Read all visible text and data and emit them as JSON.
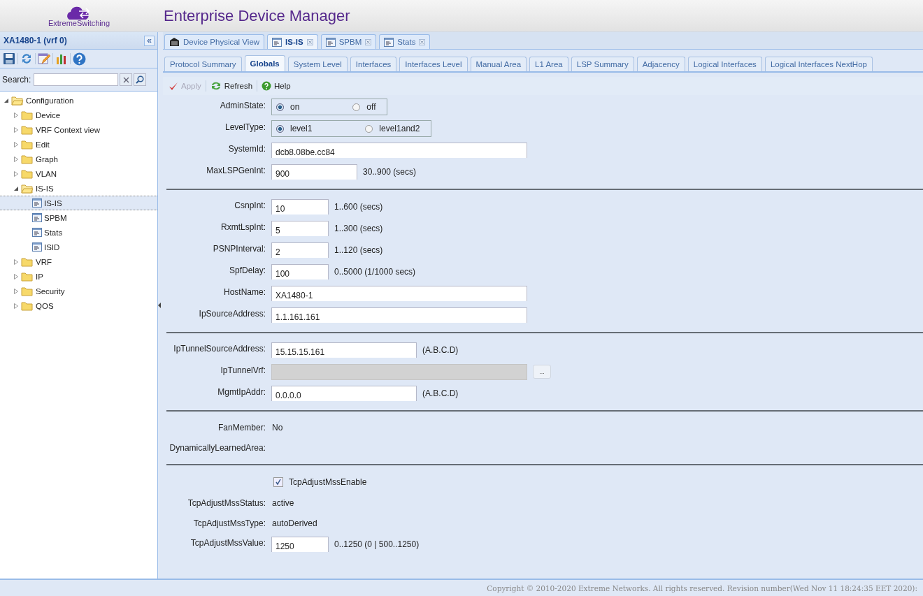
{
  "header": {
    "brand": "ExtremeSwitching",
    "title": "Enterprise Device Manager"
  },
  "sidebar": {
    "device": "XA1480-1 (vrf 0)",
    "collapse": "«",
    "search_label": "Search:",
    "tree": [
      {
        "label": "Configuration",
        "kind": "folder",
        "expanded": true,
        "selected": false,
        "children": [
          {
            "label": "Device",
            "kind": "folder",
            "expanded": false,
            "selected": false
          },
          {
            "label": "VRF Context view",
            "kind": "folder",
            "expanded": false,
            "selected": false
          },
          {
            "label": "Edit",
            "kind": "folder",
            "expanded": false,
            "selected": false
          },
          {
            "label": "Graph",
            "kind": "folder",
            "expanded": false,
            "selected": false
          },
          {
            "label": "VLAN",
            "kind": "folder",
            "expanded": false,
            "selected": false
          },
          {
            "label": "IS-IS",
            "kind": "folder",
            "expanded": true,
            "selected": false,
            "children": [
              {
                "label": "IS-IS",
                "kind": "page",
                "selected": true
              },
              {
                "label": "SPBM",
                "kind": "page",
                "selected": false
              },
              {
                "label": "Stats",
                "kind": "page",
                "selected": false
              },
              {
                "label": "ISID",
                "kind": "page",
                "selected": false
              }
            ]
          },
          {
            "label": "VRF",
            "kind": "folder",
            "expanded": false,
            "selected": false
          },
          {
            "label": "IP",
            "kind": "folder",
            "expanded": false,
            "selected": false
          },
          {
            "label": "Security",
            "kind": "folder",
            "expanded": false,
            "selected": false
          },
          {
            "label": "QOS",
            "kind": "folder",
            "expanded": false,
            "selected": false
          }
        ]
      }
    ]
  },
  "view_tabs": [
    {
      "label": "Device Physical View",
      "selected": false,
      "closable": false
    },
    {
      "label": "IS-IS",
      "selected": true,
      "closable": true
    },
    {
      "label": "SPBM",
      "selected": false,
      "closable": true
    },
    {
      "label": "Stats",
      "selected": false,
      "closable": true
    }
  ],
  "sub_tabs": [
    {
      "label": "Protocol Summary",
      "selected": false
    },
    {
      "label": "Globals",
      "selected": true
    },
    {
      "label": "System Level",
      "selected": false
    },
    {
      "label": "Interfaces",
      "selected": false
    },
    {
      "label": "Interfaces Level",
      "selected": false
    },
    {
      "label": "Manual Area",
      "selected": false
    },
    {
      "label": "L1 Area",
      "selected": false
    },
    {
      "label": "LSP Summary",
      "selected": false
    },
    {
      "label": "Adjacency",
      "selected": false
    },
    {
      "label": "Logical Interfaces",
      "selected": false
    },
    {
      "label": "Logical Interfaces NextHop",
      "selected": false
    }
  ],
  "toolbar": [
    {
      "label": "Apply",
      "kind": "apply",
      "disabled": true
    },
    {
      "label": "Refresh",
      "kind": "refresh",
      "disabled": false
    },
    {
      "label": "Help",
      "kind": "help",
      "disabled": false
    }
  ],
  "sections": [
    [
      {
        "kind": "radio",
        "label": "AdminState:",
        "options": [
          {
            "label": "on",
            "selected": true
          },
          {
            "label": "off",
            "selected": false
          }
        ]
      },
      {
        "kind": "radio",
        "label": "LevelType:",
        "options": [
          {
            "label": "level1",
            "selected": true
          },
          {
            "label": "level1and2",
            "selected": false
          }
        ]
      },
      {
        "kind": "line",
        "label": "SystemId:",
        "value": "dcb8.08be.cc84"
      },
      {
        "kind": "interval",
        "label": "MaxLSPGenInt:",
        "value": "900",
        "hint": "30..900 (secs)"
      }
    ],
    [
      {
        "kind": "number",
        "label": "CsnpInt:",
        "value": "10",
        "hint": "1..600 (secs)"
      },
      {
        "kind": "number",
        "label": "RxmtLspInt:",
        "value": "5",
        "hint": "1..300 (secs)"
      },
      {
        "kind": "number",
        "label": "PSNPInterval:",
        "value": "2",
        "hint": "1..120 (secs)"
      },
      {
        "kind": "number",
        "label": "SpfDelay:",
        "value": "100",
        "hint": "0..5000 (1/1000 secs)"
      },
      {
        "kind": "line",
        "label": "HostName:",
        "value": "XA1480-1"
      },
      {
        "kind": "line",
        "label": "IpSourceAddress:",
        "value": "1.1.161.161"
      }
    ],
    [
      {
        "kind": "address",
        "label": "IpTunnelSourceAddress:",
        "value": "15.15.15.161",
        "hint": "(A.B.C.D)"
      },
      {
        "kind": "picker",
        "label": "IpTunnelVrf:",
        "button": "...",
        "disabled": true
      },
      {
        "kind": "address",
        "label": "MgmtIpAddr:",
        "value": "0.0.0.0",
        "hint": "(A.B.C.D)"
      }
    ],
    [
      {
        "kind": "readonly",
        "label": "FanMember:",
        "value": "No"
      },
      {
        "kind": "readonly",
        "label": "DynamicallyLearnedArea:"
      }
    ],
    [
      {
        "kind": "checkbox",
        "label": "TcpAdjustMssEnable",
        "checked": true
      },
      {
        "kind": "readonly",
        "label": "TcpAdjustMssStatus:",
        "value": "active"
      },
      {
        "kind": "readonly",
        "label": "TcpAdjustMssType:",
        "value": "autoDerived"
      },
      {
        "kind": "number",
        "label": "TcpAdjustMssValue:",
        "value": "1250",
        "hint": "0..1250 (0 | 500..1250)"
      }
    ]
  ],
  "status_bar": "Copyright © 2010-2020 Extreme Networks. All rights reserved. Revision number(Wed Nov 11 18:24:35 EET 2020):"
}
